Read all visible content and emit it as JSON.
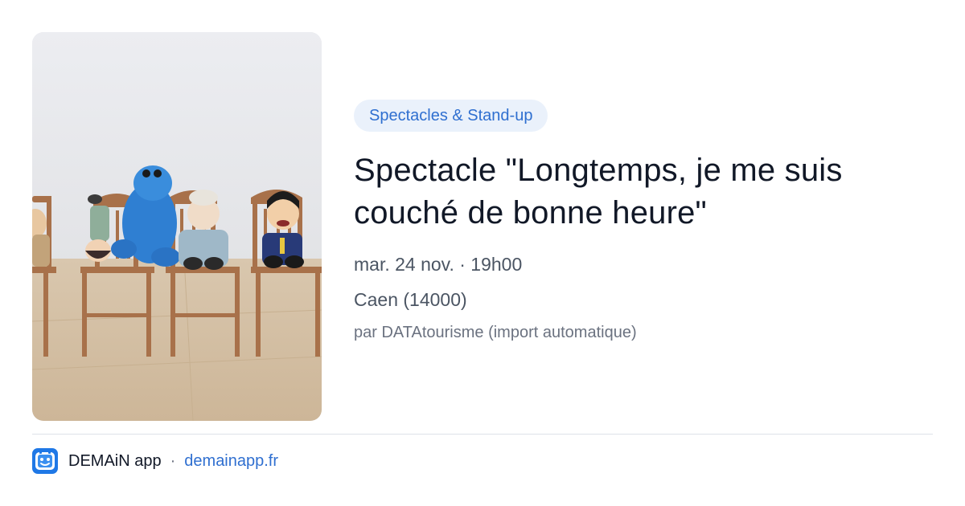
{
  "event": {
    "image_alt": "Marionnettes assises sur des chaises en bois",
    "category": "Spectacles & Stand-up",
    "title": "Spectacle \"Longtemps, je me suis couché de bonne heure\"",
    "datetime": "mar. 24 nov. · 19h00",
    "location": "Caen (14000)",
    "source": "par DATAtourisme (import automatique)"
  },
  "footer": {
    "app_name": "DEMAiN app",
    "separator": "·",
    "link": "demainapp.fr",
    "logo_icon": "demain-logo-icon"
  },
  "colors": {
    "accent": "#2f6fd0",
    "badge_bg": "#eaf1fb",
    "title": "#111827",
    "muted": "#4b5563",
    "divider": "#dde2e8"
  }
}
